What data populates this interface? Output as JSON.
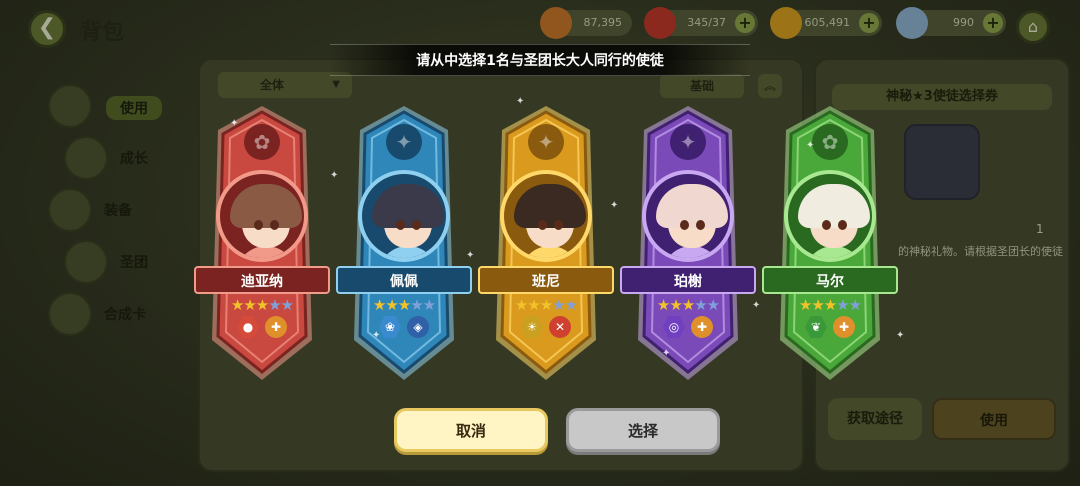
{
  "header": {
    "back_icon": "chevron-left-icon",
    "title": "背包",
    "resources": [
      {
        "icon": "bread-icon",
        "value": "87,395",
        "color": "#c9782a",
        "plus": false
      },
      {
        "icon": "red-gem-icon",
        "value": "345/37",
        "color": "#c23a2a",
        "plus": true
      },
      {
        "icon": "gold-coin-icon",
        "value": "605,491",
        "color": "#d8a020",
        "plus": true
      },
      {
        "icon": "feather-icon",
        "value": "990",
        "color": "#8fb4d0",
        "plus": true
      }
    ],
    "plus_symbol": "+",
    "home_icon": "home-icon"
  },
  "sidebar": {
    "tabs": [
      {
        "label": "使用",
        "icon": "use-icon",
        "active": true
      },
      {
        "label": "成长",
        "icon": "growth-icon",
        "active": false
      },
      {
        "label": "装备",
        "icon": "equipment-icon",
        "active": false
      },
      {
        "label": "圣团",
        "icon": "guild-icon",
        "active": false
      },
      {
        "label": "合成卡",
        "icon": "card-icon",
        "active": false
      }
    ]
  },
  "inventory": {
    "filter_all": "全体",
    "filter_basic": "基础",
    "collapse_icon": "double-chevron-up-icon"
  },
  "detail": {
    "title": "神秘★3使徒选择券",
    "count": "1",
    "description": "的神秘礼物。请根据圣团长的使徒",
    "acquire_label": "获取途径",
    "use_label": "使用"
  },
  "modal": {
    "title": "请从中选择1名与圣团长大人同行的使徒",
    "cancel_label": "取消",
    "select_label": "选择",
    "characters": [
      {
        "name": "迪亚纳",
        "stars": 3,
        "max_stars": 5,
        "theme": "#c9483f",
        "light": "#f29a8a",
        "dark": "#7a2320",
        "hair": "#8a5a44",
        "class_icon": "paw-icon",
        "class_glyph": "✿",
        "badges": [
          {
            "icon": "fire-drop-icon",
            "glyph": "●",
            "color": "#d64a3a",
            "shape": "hex"
          },
          {
            "icon": "healer-cross-icon",
            "glyph": "✚",
            "color": "#e0902a",
            "shape": "circ"
          }
        ]
      },
      {
        "name": "佩佩",
        "stars": 3,
        "max_stars": 5,
        "theme": "#2f86b8",
        "light": "#8fd0f0",
        "dark": "#184a6e",
        "hair": "#3a3a4a",
        "class_icon": "star-icon",
        "class_glyph": "✦",
        "badges": [
          {
            "icon": "water-flower-icon",
            "glyph": "❀",
            "color": "#3a8ad0",
            "shape": "hex"
          },
          {
            "icon": "shield-icon",
            "glyph": "◈",
            "color": "#3060a8",
            "shape": "circ"
          }
        ]
      },
      {
        "name": "班尼",
        "stars": 3,
        "max_stars": 5,
        "theme": "#d99a1e",
        "light": "#ffd86a",
        "dark": "#8a5a0e",
        "hair": "#3a2a22",
        "class_icon": "star-icon",
        "class_glyph": "✦",
        "badges": [
          {
            "icon": "light-sun-icon",
            "glyph": "☀",
            "color": "#c9a020",
            "shape": "hex"
          },
          {
            "icon": "swords-icon",
            "glyph": "✕",
            "color": "#d04030",
            "shape": "circ"
          }
        ]
      },
      {
        "name": "珀榭",
        "stars": 3,
        "max_stars": 5,
        "theme": "#7a4ab8",
        "light": "#c8a8f0",
        "dark": "#402070",
        "hair": "#f0d8d0",
        "class_icon": "star-icon",
        "class_glyph": "✦",
        "badges": [
          {
            "icon": "dark-swirl-icon",
            "glyph": "◎",
            "color": "#7040c0",
            "shape": "hex"
          },
          {
            "icon": "healer-cross-icon",
            "glyph": "✚",
            "color": "#e0902a",
            "shape": "circ"
          }
        ]
      },
      {
        "name": "马尔",
        "stars": 3,
        "max_stars": 5,
        "theme": "#4aa83a",
        "light": "#a8e890",
        "dark": "#2a6a20",
        "hair": "#f0ece0",
        "class_icon": "paw-icon",
        "class_glyph": "✿",
        "badges": [
          {
            "icon": "nature-leaf-icon",
            "glyph": "❦",
            "color": "#3a9a3a",
            "shape": "hex"
          },
          {
            "icon": "healer-cross-icon",
            "glyph": "✚",
            "color": "#e0902a",
            "shape": "circ"
          }
        ]
      }
    ]
  },
  "colors": {
    "cancel_bg": "#fff4c4",
    "select_bg": "#c8c8c8",
    "star_gold": "#f2c22a",
    "star_blue": "#7fa0d8"
  }
}
